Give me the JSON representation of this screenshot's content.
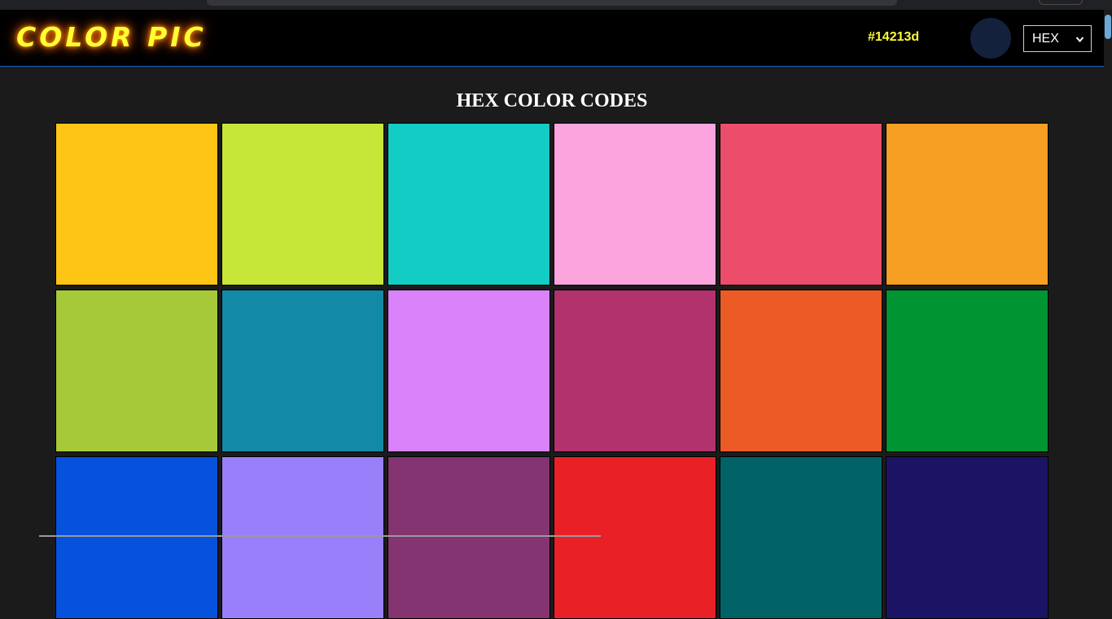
{
  "header": {
    "logo": "COLOR PIC",
    "current_color_code": "#14213d",
    "current_color": "#14213d",
    "format_select": {
      "selected": "HEX"
    }
  },
  "main": {
    "title": "HEX COLOR CODES",
    "swatches": [
      "#ffc515",
      "#c6e638",
      "#13ccc4",
      "#fba4dd",
      "#ec4d6b",
      "#f79f22",
      "#a6c939",
      "#1289a7",
      "#d982f9",
      "#b2326e",
      "#ec5b26",
      "#009432",
      "#0652dd",
      "#9980fa",
      "#833471",
      "#ea2027",
      "#006266",
      "#1b1464"
    ]
  },
  "colors": {
    "logo_text": "#ffff33",
    "header_bg": "#000000",
    "page_bg": "#1b1b1b",
    "header_border": "#1f5fc4"
  },
  "icons": {
    "select_chevron": "chevron-down-icon"
  }
}
